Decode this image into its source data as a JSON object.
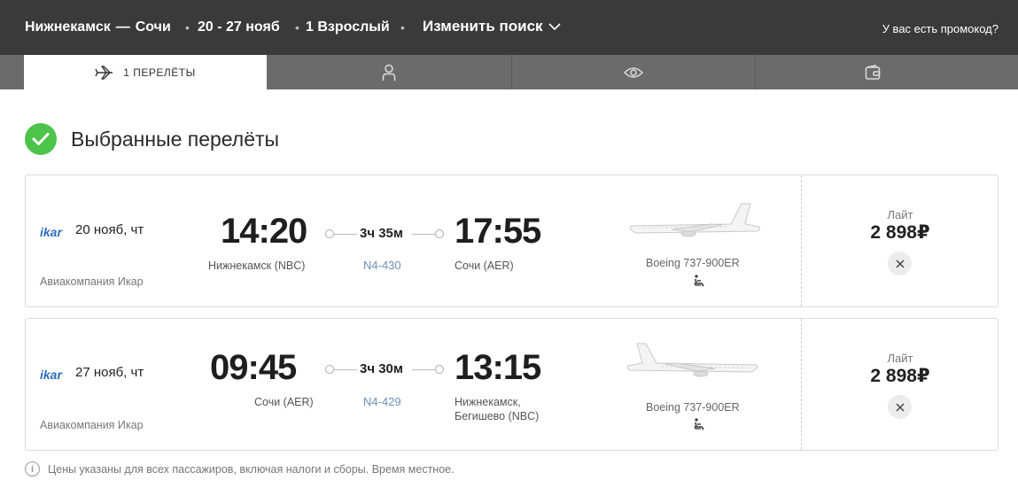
{
  "header": {
    "origin": "Нижнекамск",
    "route_sep": "—",
    "destination": "Сочи",
    "dates": "20 - 27 нояб",
    "passengers": "1 Взрослый",
    "change_search": "Изменить поиск",
    "promo": "У вас есть промокод?"
  },
  "tabs": [
    {
      "label": "1  ПЕРЕЛЁТЫ",
      "icon": "plane-icon",
      "active": true
    },
    {
      "label": "",
      "icon": "passenger-icon",
      "active": false
    },
    {
      "label": "",
      "icon": "eye-icon",
      "active": false
    },
    {
      "label": "",
      "icon": "wallet-icon",
      "active": false
    }
  ],
  "section": {
    "title": "Выбранные перелёты"
  },
  "flights": [
    {
      "logo": "ikar",
      "date": "20 нояб, чт",
      "airline": "Авиакомпания Икар",
      "dep_time": "14:20",
      "dep_city": "Нижнекамск (NBC)",
      "duration": "3ч 35м",
      "flight_no": "N4-430",
      "arr_time": "17:55",
      "arr_city": "Сочи (AER)",
      "aircraft": "Boeing 737-900ER",
      "fare": "Лайт",
      "price": "2 898₽"
    },
    {
      "logo": "ikar",
      "date": "27 нояб, чт",
      "airline": "Авиакомпания Икар",
      "dep_time": "09:45",
      "dep_city": "Сочи (AER)",
      "duration": "3ч 30м",
      "flight_no": "N4-429",
      "arr_time": "13:15",
      "arr_city_line1": "Нижнекамск,",
      "arr_city_line2": "Бегишево (NBC)",
      "aircraft": "Boeing 737-900ER",
      "fare": "Лайт",
      "price": "2 898₽"
    }
  ],
  "footnote": "Цены указаны для всех пассажиров, включая налоги и сборы. Время местное.",
  "colors": {
    "header_bg": "#3a3a3a",
    "tabs_bg": "#6b6b6b",
    "check": "#4cc44a",
    "link": "#6d8fb5",
    "logo": "#2a6ebd"
  }
}
